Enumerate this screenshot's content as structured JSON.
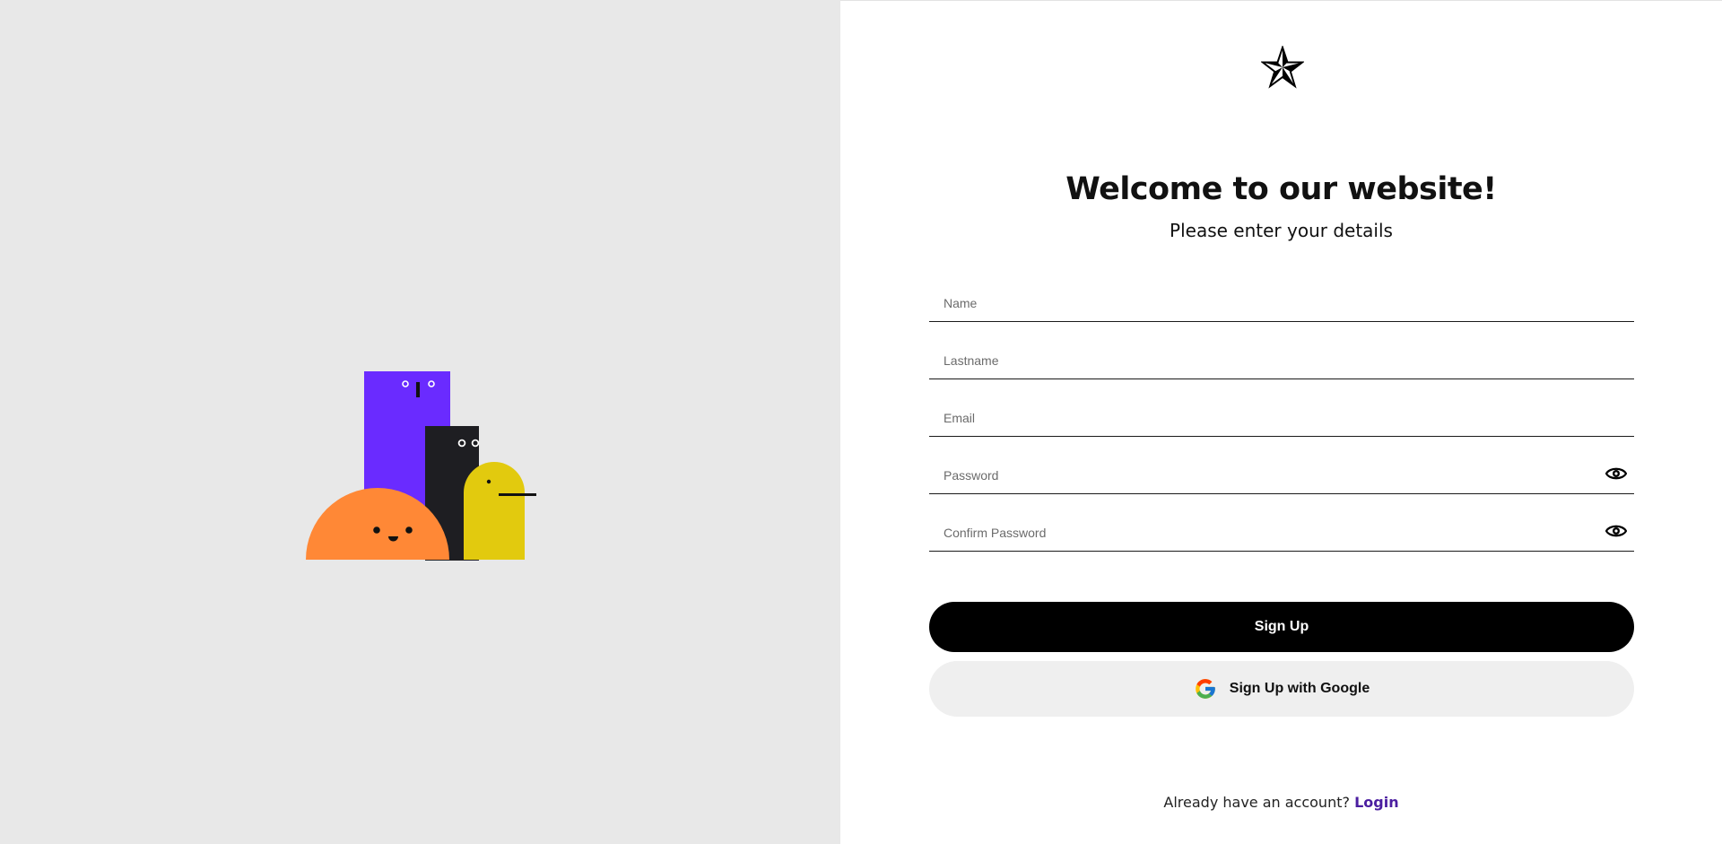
{
  "illustration": {
    "name": "characters-illustration",
    "colors": {
      "purple": "#6a2bff",
      "dark": "#1e1e22",
      "orange": "#ff8836",
      "yellow": "#e2ca0e",
      "background": "#e8e8e8"
    }
  },
  "logo": {
    "icon": "star-icon"
  },
  "header": {
    "title": "Welcome to our website!",
    "subtitle": "Please enter your details"
  },
  "form": {
    "name_placeholder": "Name",
    "lastname_placeholder": "Lastname",
    "email_placeholder": "Email",
    "password_placeholder": "Password",
    "confirm_password_placeholder": "Confirm Password",
    "password_toggle_icon": "eye-icon"
  },
  "actions": {
    "signup_label": "Sign Up",
    "google_signup_label": "Sign Up with Google",
    "google_icon": "google-icon"
  },
  "footer": {
    "prompt": "Already have an account?",
    "login_label": "Login"
  },
  "colors": {
    "accent": "#000000",
    "link": "#4b1ea0",
    "google_button_bg": "#efefef"
  }
}
